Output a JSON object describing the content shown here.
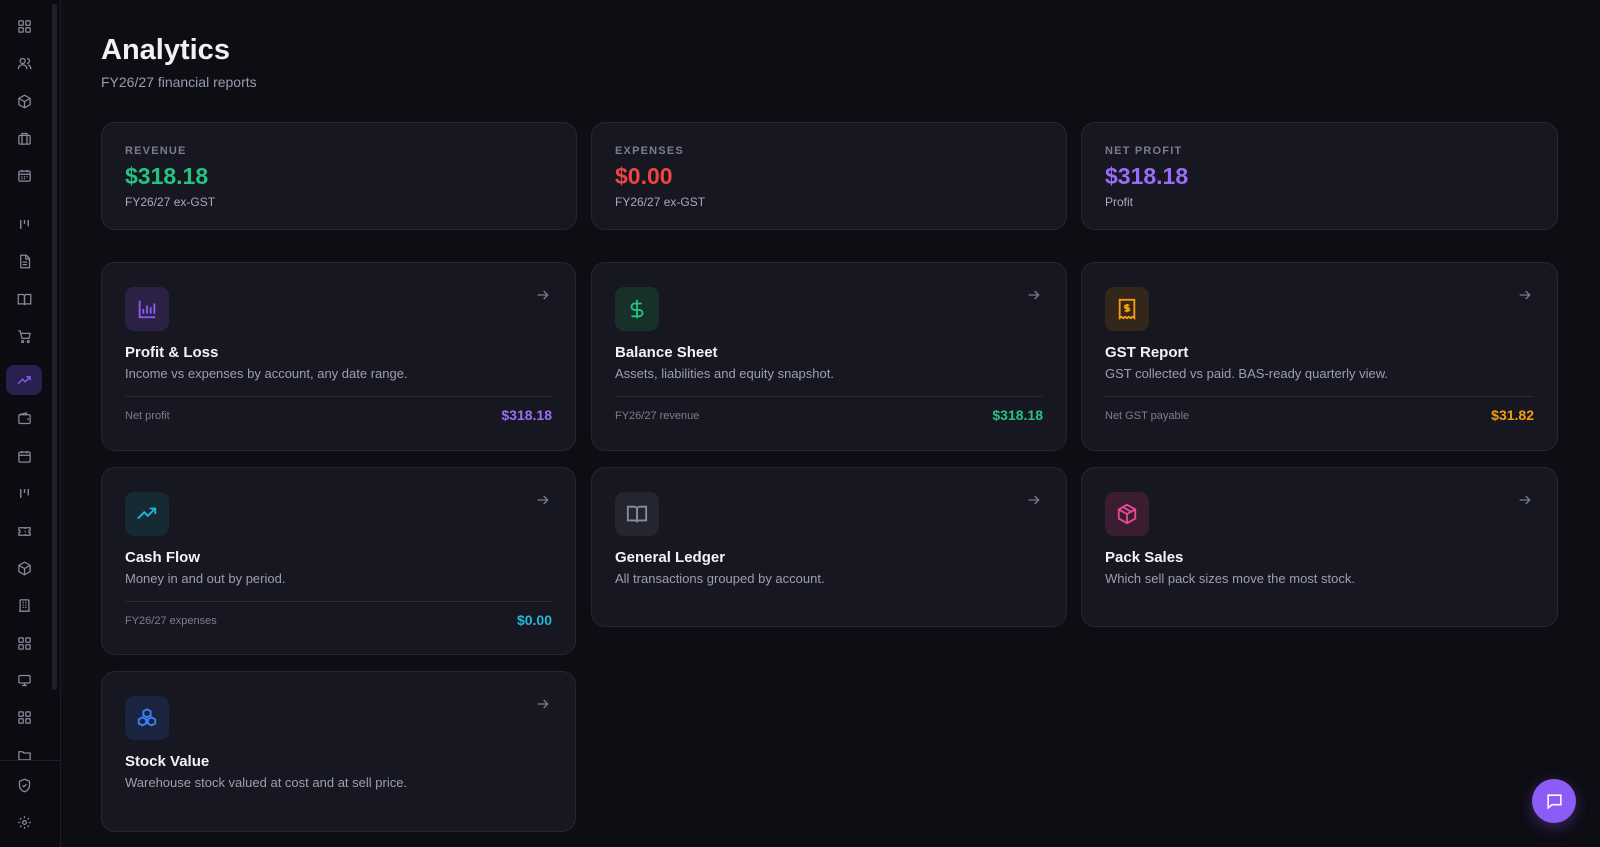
{
  "header": {
    "title": "Analytics",
    "subtitle": "FY26/27 financial reports"
  },
  "stats": [
    {
      "label": "REVENUE",
      "value": "$318.18",
      "sub": "FY26/27 ex-GST",
      "color": "#22c383"
    },
    {
      "label": "EXPENSES",
      "value": "$0.00",
      "sub": "FY26/27 ex-GST",
      "color": "#ef4444"
    },
    {
      "label": "NET PROFIT",
      "value": "$318.18",
      "sub": "Profit",
      "color": "#9b6cf7"
    }
  ],
  "reports": [
    {
      "title": "Profit & Loss",
      "desc": "Income vs expenses by account, any date range.",
      "foot_label": "Net profit",
      "foot_value": "$318.18",
      "icon": "bar-chart-icon",
      "accent": "#8b5cf6",
      "icon_bg": "#2a2144"
    },
    {
      "title": "Balance Sheet",
      "desc": "Assets, liabilities and equity snapshot.",
      "foot_label": "FY26/27 revenue",
      "foot_value": "$318.18",
      "icon": "dollar-icon",
      "accent": "#22c383",
      "icon_bg": "#17302a"
    },
    {
      "title": "GST Report",
      "desc": "GST collected vs paid. BAS-ready quarterly view.",
      "foot_label": "Net GST payable",
      "foot_value": "$31.82",
      "icon": "receipt-icon",
      "accent": "#f59e0b",
      "icon_bg": "#33261a"
    },
    {
      "title": "Cash Flow",
      "desc": "Money in and out by period.",
      "foot_label": "FY26/27 expenses",
      "foot_value": "$0.00",
      "icon": "trending-up-icon",
      "accent": "#22b8d4",
      "icon_bg": "#162a33"
    },
    {
      "title": "General Ledger",
      "desc": "All transactions grouped by account.",
      "icon": "book-icon",
      "accent": "#8a8aa0",
      "icon_bg": "#252530"
    },
    {
      "title": "Pack Sales",
      "desc": "Which sell pack sizes move the most stock.",
      "icon": "package-icon",
      "accent": "#ec4899",
      "icon_bg": "#3a1d30"
    },
    {
      "title": "Stock Value",
      "desc": "Warehouse stock valued at cost and at sell price.",
      "icon": "boxes-icon",
      "accent": "#3b82f6",
      "icon_bg": "#1a2440"
    }
  ],
  "sidebar": {
    "items": [
      {
        "icon": "grid-icon"
      },
      {
        "icon": "users-icon"
      },
      {
        "icon": "cube-icon"
      },
      {
        "icon": "briefcase-icon"
      },
      {
        "icon": "calendar-icon"
      },
      {
        "icon": "kanban-icon"
      },
      {
        "icon": "document-icon"
      },
      {
        "icon": "book-icon"
      },
      {
        "icon": "cart-icon"
      },
      {
        "icon": "trending-up-icon",
        "active": true
      },
      {
        "icon": "wallet-icon"
      },
      {
        "icon": "calendar-icon"
      },
      {
        "icon": "kanban-icon"
      },
      {
        "icon": "ticket-icon"
      },
      {
        "icon": "cube-icon"
      },
      {
        "icon": "building-icon"
      },
      {
        "icon": "grid-icon"
      },
      {
        "icon": "monitor-icon"
      },
      {
        "icon": "grid-icon"
      },
      {
        "icon": "folder-icon"
      }
    ],
    "bottom": [
      {
        "icon": "shield-icon"
      },
      {
        "icon": "gear-icon"
      }
    ]
  },
  "chat": {
    "icon": "chat-icon"
  }
}
